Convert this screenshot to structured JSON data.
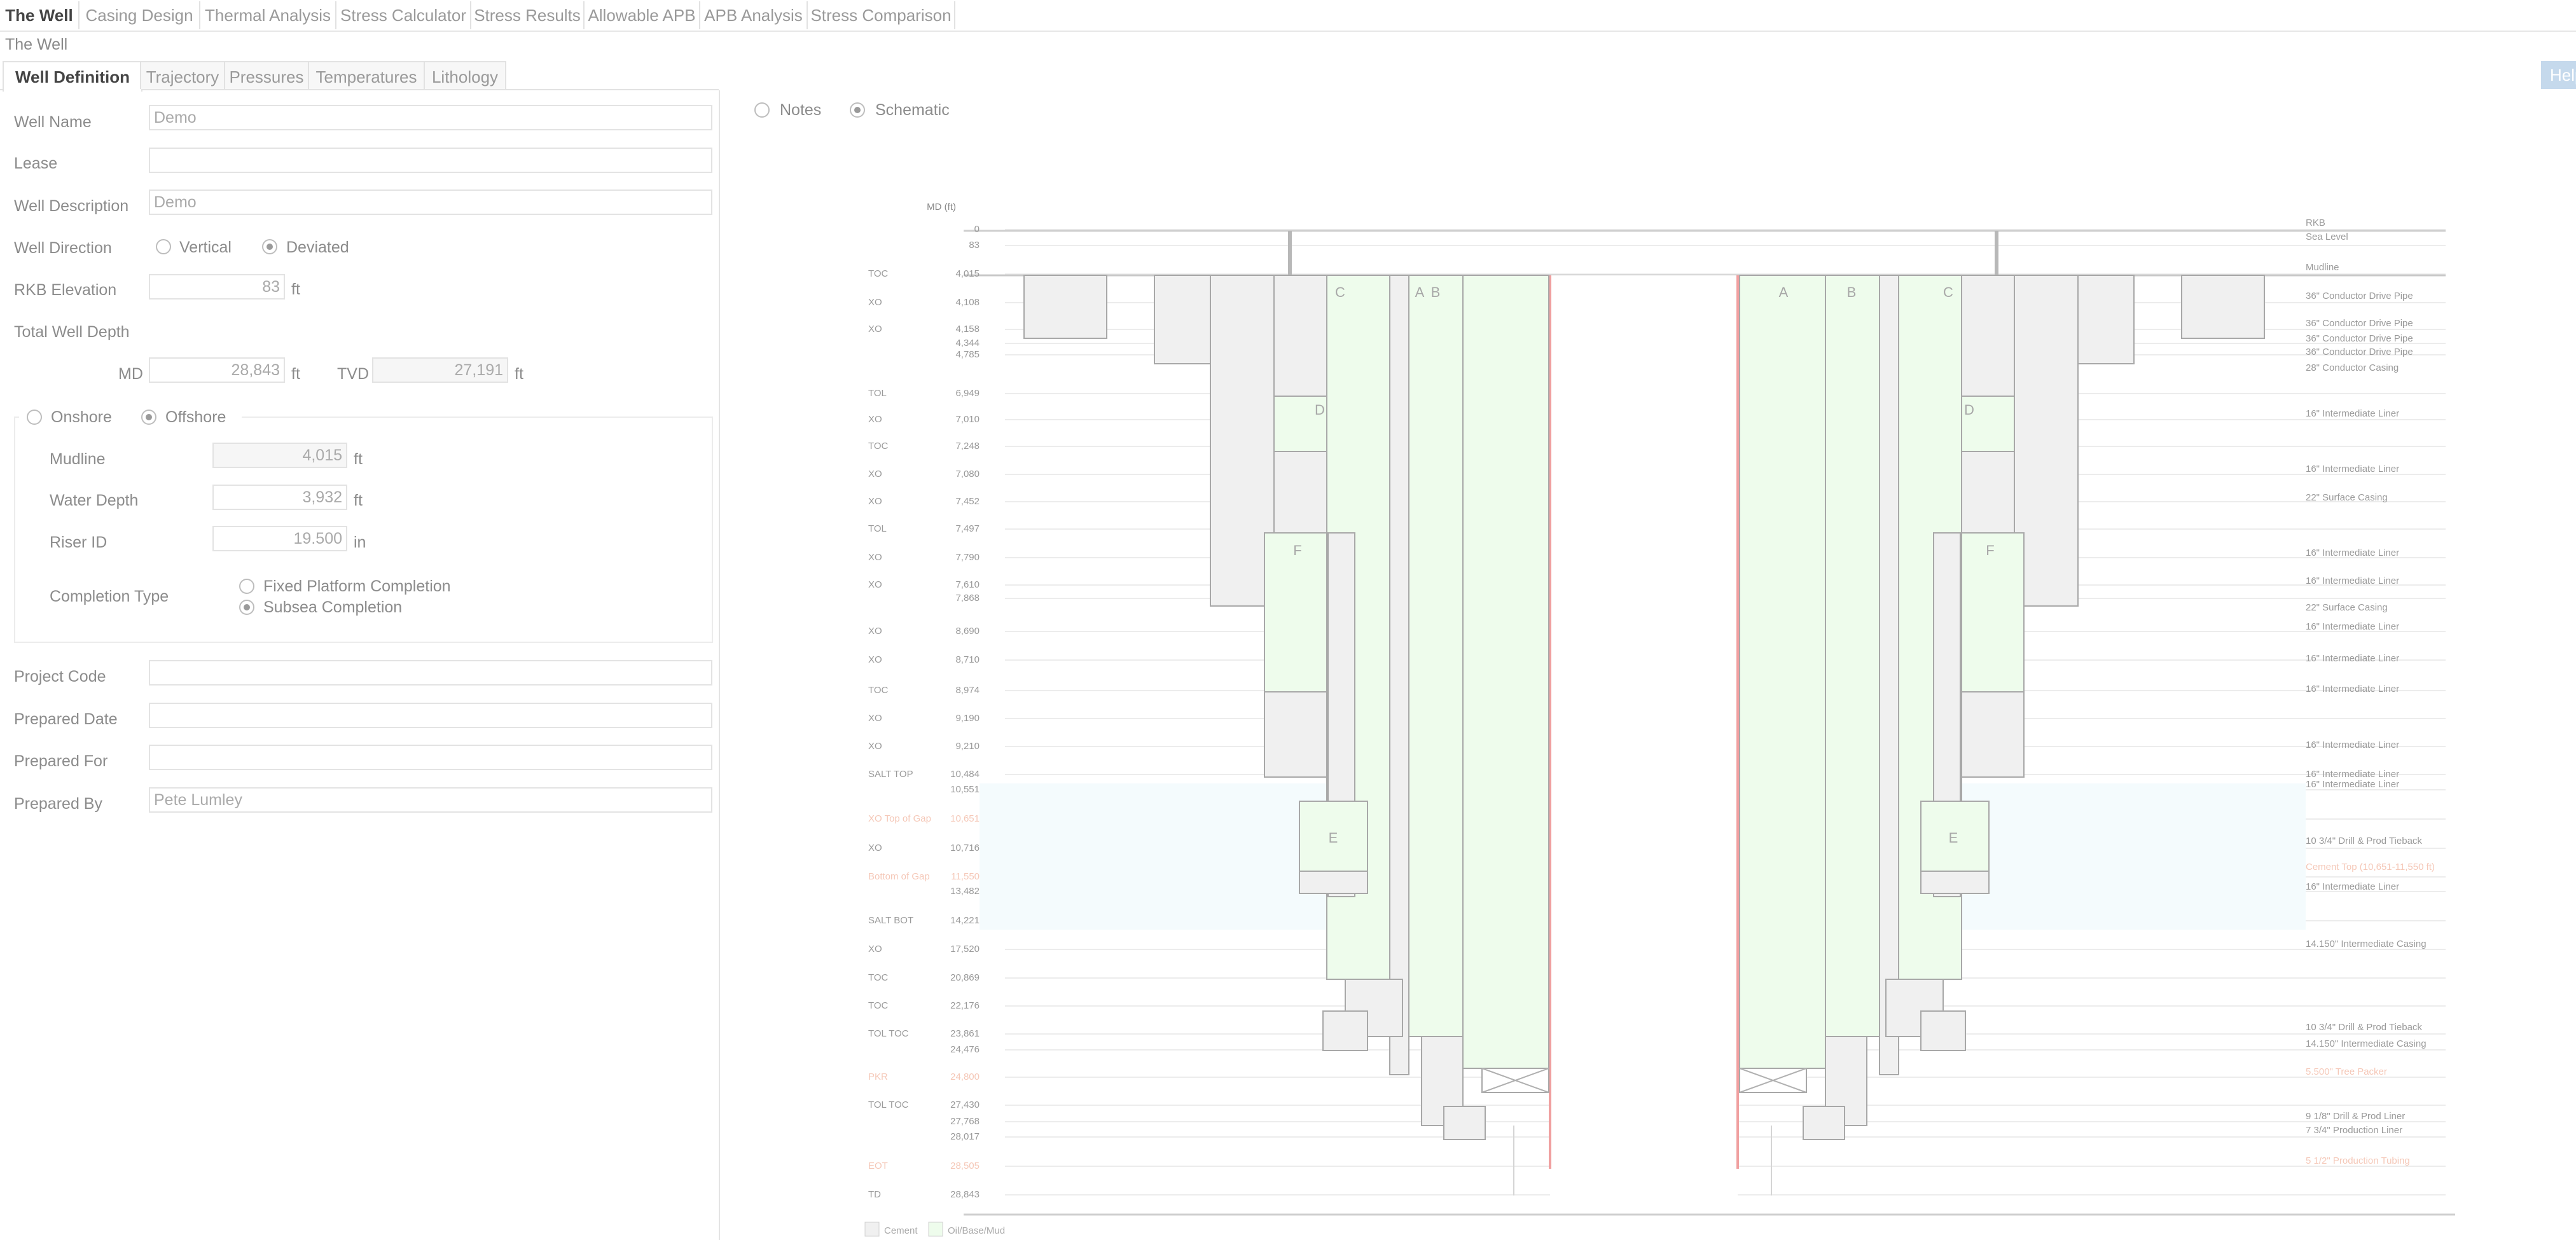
{
  "app": {
    "tabs": [
      {
        "label": "The Well"
      },
      {
        "label": "Casing Design"
      },
      {
        "label": "Thermal Analysis"
      },
      {
        "label": "Stress Calculator"
      },
      {
        "label": "Stress Results"
      },
      {
        "label": "Allowable APB"
      },
      {
        "label": "APB Analysis"
      },
      {
        "label": "Stress Comparison"
      }
    ],
    "subtitle": "The Well",
    "subtabs": [
      {
        "label": "Well Definition"
      },
      {
        "label": "Trajectory"
      },
      {
        "label": "Pressures"
      },
      {
        "label": "Temperatures"
      },
      {
        "label": "Lithology"
      }
    ],
    "help_label": "Help"
  },
  "form": {
    "well_name": {
      "label": "Well Name",
      "value": "Demo"
    },
    "lease": {
      "label": "Lease",
      "value": ""
    },
    "well_description": {
      "label": "Well Description",
      "value": "Demo"
    },
    "well_direction": {
      "label": "Well Direction",
      "options": [
        "Vertical",
        "Deviated"
      ],
      "selected": "Deviated"
    },
    "rkb_elevation": {
      "label": "RKB Elevation",
      "value": "83",
      "unit": "ft"
    },
    "total_well_depth": {
      "label": "Total Well Depth",
      "md_label": "MD",
      "md_value": "28,843",
      "md_unit": "ft",
      "tvd_label": "TVD",
      "tvd_value": "27,191",
      "tvd_unit": "ft"
    },
    "location": {
      "options": [
        "Onshore",
        "Offshore"
      ],
      "selected": "Offshore"
    },
    "mudline": {
      "label": "Mudline",
      "value": "4,015",
      "unit": "ft"
    },
    "water_depth": {
      "label": "Water Depth",
      "value": "3,932",
      "unit": "ft"
    },
    "riser_id": {
      "label": "Riser ID",
      "value": "19.500",
      "unit": "in"
    },
    "completion_type": {
      "label": "Completion Type",
      "options": [
        "Fixed Platform Completion",
        "Subsea Completion"
      ],
      "selected": "Subsea Completion"
    },
    "project_code": {
      "label": "Project Code",
      "value": ""
    },
    "prepared_date": {
      "label": "Prepared Date",
      "value": ""
    },
    "prepared_for": {
      "label": "Prepared For",
      "value": ""
    },
    "prepared_by": {
      "label": "Prepared By",
      "value": "Pete Lumley"
    }
  },
  "view": {
    "options": [
      "Notes",
      "Schematic"
    ],
    "selected": "Schematic"
  },
  "schematic": {
    "axis_title": "MD (ft)",
    "left_labels": [
      {
        "kind": "",
        "md": "0"
      },
      {
        "kind": "",
        "md": "83"
      },
      {
        "kind": "TOC",
        "md": "4,015"
      },
      {
        "kind": "XO",
        "md": "4,108"
      },
      {
        "kind": "XO",
        "md": "4,158"
      },
      {
        "kind": "",
        "md": "4,344"
      },
      {
        "kind": "",
        "md": "4,785"
      },
      {
        "kind": "TOL",
        "md": "6,949"
      },
      {
        "kind": "XO",
        "md": "7,010"
      },
      {
        "kind": "TOC",
        "md": "7,248"
      },
      {
        "kind": "XO",
        "md": "7,080"
      },
      {
        "kind": "XO",
        "md": "7,452"
      },
      {
        "kind": "TOL",
        "md": "7,497"
      },
      {
        "kind": "XO",
        "md": "7,790"
      },
      {
        "kind": "XO",
        "md": "7,610"
      },
      {
        "kind": "",
        "md": "7,868"
      },
      {
        "kind": "XO",
        "md": "8,690"
      },
      {
        "kind": "XO",
        "md": "8,710"
      },
      {
        "kind": "TOC",
        "md": "8,974"
      },
      {
        "kind": "XO",
        "md": "9,190"
      },
      {
        "kind": "XO",
        "md": "9,210"
      },
      {
        "kind": "SALT TOP",
        "md": "10,484"
      },
      {
        "kind": "",
        "md": "10,551"
      },
      {
        "kind": "XO Top of Gap",
        "md": "10,651"
      },
      {
        "kind": "XO",
        "md": "10,716"
      },
      {
        "kind": "Bottom of Gap",
        "md": "11,550"
      },
      {
        "kind": "",
        "md": "13,482"
      },
      {
        "kind": "SALT BOT",
        "md": "14,221"
      },
      {
        "kind": "XO",
        "md": "17,520"
      },
      {
        "kind": "TOC",
        "md": "20,869"
      },
      {
        "kind": "TOC",
        "md": "22,176"
      },
      {
        "kind": "TOL TOC",
        "md": "23,861"
      },
      {
        "kind": "",
        "md": "24,476"
      },
      {
        "kind": "PKR",
        "md": "24,800"
      },
      {
        "kind": "TOL TOC",
        "md": "27,430"
      },
      {
        "kind": "",
        "md": "27,768"
      },
      {
        "kind": "",
        "md": "28,017"
      },
      {
        "kind": "EOT",
        "md": "28,505"
      },
      {
        "kind": "TD",
        "md": "28,843"
      }
    ],
    "right_labels": [
      "RKB",
      "Sea Level",
      "Mudline",
      "36\" Conductor Drive Pipe",
      "36\" Conductor Drive Pipe",
      "36\" Conductor Drive Pipe",
      "36\" Conductor Drive Pipe",
      "28\" Conductor Casing",
      "16\" Intermediate Liner",
      "16\" Intermediate Liner",
      "22\" Surface Casing",
      "16\" Intermediate Liner",
      "16\" Intermediate Liner",
      "22\" Surface Casing",
      "16\" Intermediate Liner",
      "16\" Intermediate Liner",
      "16\" Intermediate Liner",
      "16\" Intermediate Liner",
      "16\" Intermediate Liner",
      "16\" Intermediate Liner",
      "10 3/4\" Drill & Prod Tieback",
      "Cement Top (10,651-11,550 ft)",
      "16\" Intermediate Liner",
      "14.150\" Intermediate Casing",
      "10 3/4\" Drill & Prod Tieback",
      "14.150\" Intermediate Casing",
      "5.500\" Tree Packer",
      "9 1/8\" Drill & Prod Liner",
      "7 3/4\" Production Liner",
      "5 1/2\" Production Tubing"
    ],
    "annuli": [
      "A",
      "B",
      "C",
      "D",
      "E",
      "F"
    ],
    "legend": [
      "Cement",
      "Oil/Base/Mud"
    ],
    "colors": {
      "cement": "#f0f0f0",
      "fluid": "#eefcec",
      "salt": "#f4fbfd",
      "tubing": "#f0a0a0",
      "highlight": "#f5c8b8"
    }
  }
}
